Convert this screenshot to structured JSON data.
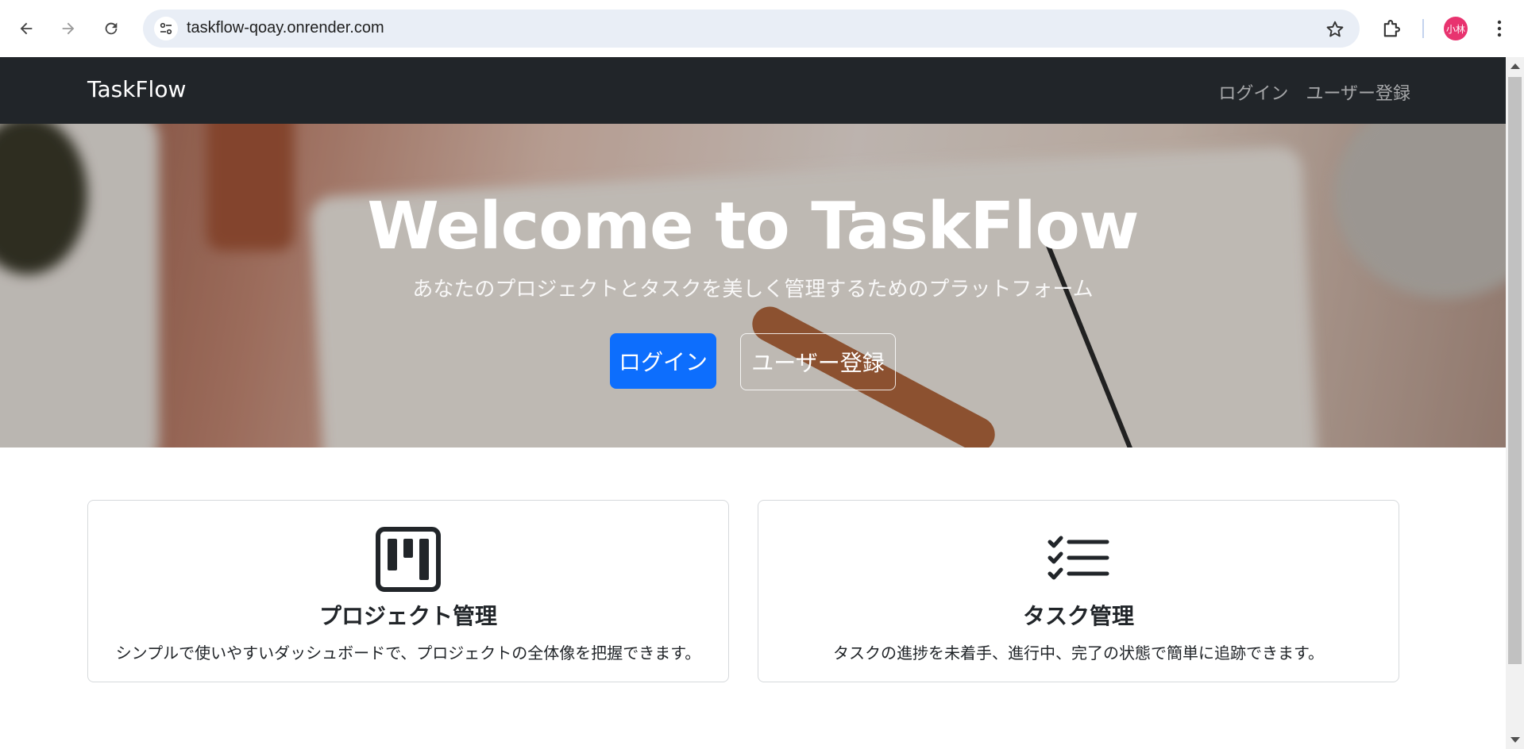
{
  "browser": {
    "url": "taskflow-qoay.onrender.com",
    "profile_initials": "小林",
    "profile_color": "#e8336f"
  },
  "navbar": {
    "brand": "TaskFlow",
    "links": [
      {
        "label": "ログイン"
      },
      {
        "label": "ユーザー登録"
      }
    ],
    "background": "#212529"
  },
  "hero": {
    "title": "Welcome to TaskFlow",
    "subtitle": "あなたのプロジェクトとタスクを美しく管理するためのプラットフォーム",
    "primary_button": "ログイン",
    "secondary_button": "ユーザー登録",
    "accent": "#0d6efd"
  },
  "features": [
    {
      "icon": "kanban-icon",
      "title": "プロジェクト管理",
      "description": "シンプルで使いやすいダッシュボードで、プロジェクトの全体像を把握できます。"
    },
    {
      "icon": "checklist-icon",
      "title": "タスク管理",
      "description": "タスクの進捗を未着手、進行中、完了の状態で簡単に追跡できます。"
    }
  ]
}
